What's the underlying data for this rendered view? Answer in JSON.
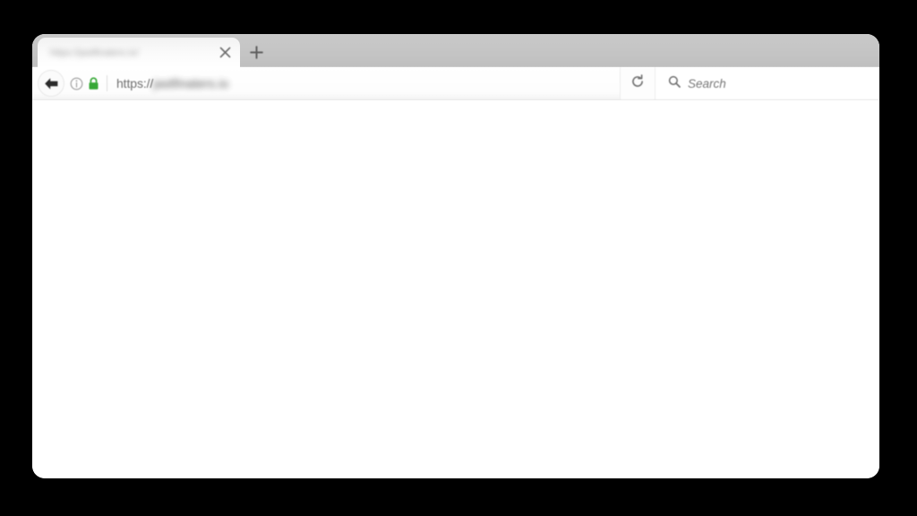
{
  "window": {
    "type": "web-browser-window",
    "chrome_style": "firefox-light"
  },
  "tab_strip": {
    "tabs": [
      {
        "title": "https://jastfinaters.io/",
        "title_redacted": true,
        "active": true,
        "close_label": "×"
      }
    ],
    "new_tab_label": "+"
  },
  "toolbar": {
    "back_label": "←",
    "info_icon_label": "ⓘ",
    "lock_icon_label": "lock",
    "lock_color": "#36a836",
    "url_scheme": "https://",
    "url_host": "jastfinaters.io",
    "url_host_redacted": true,
    "reload_label": "↻"
  },
  "search": {
    "placeholder": "Search"
  },
  "content": {
    "body_text": "",
    "background": "#ffffff"
  },
  "colors": {
    "tabstrip_bg": "#c6c6c6",
    "toolbar_bg": "#ffffff",
    "desktop_bg": "#000000",
    "lock_green": "#36a836",
    "text_muted": "#787878"
  }
}
